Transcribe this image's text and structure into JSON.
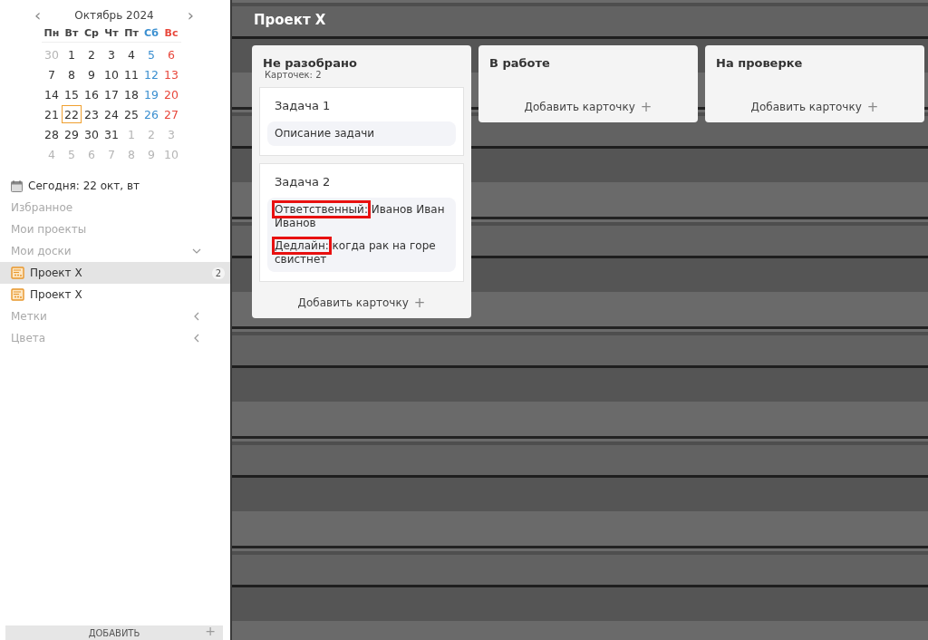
{
  "calendar": {
    "month": "Октябрь 2024",
    "prev": "‹",
    "next": "›",
    "weekdays": [
      {
        "label": "Пн",
        "color": "#444444"
      },
      {
        "label": "Вт",
        "color": "#444444"
      },
      {
        "label": "Ср",
        "color": "#444444"
      },
      {
        "label": "Чт",
        "color": "#444444"
      },
      {
        "label": "Пт",
        "color": "#444444"
      },
      {
        "label": "Сб",
        "color": "#3a8fd0"
      },
      {
        "label": "Вс",
        "color": "#e8473b"
      }
    ],
    "weeks": [
      [
        {
          "day": "30",
          "muted": true,
          "selected": false
        },
        {
          "day": "1",
          "muted": false,
          "selected": false
        },
        {
          "day": "2",
          "muted": false,
          "selected": false
        },
        {
          "day": "3",
          "muted": false,
          "selected": false
        },
        {
          "day": "4",
          "muted": false,
          "selected": false
        },
        {
          "day": "5",
          "muted": false,
          "selected": false
        },
        {
          "day": "6",
          "muted": false,
          "selected": false
        }
      ],
      [
        {
          "day": "7",
          "muted": false,
          "selected": false
        },
        {
          "day": "8",
          "muted": false,
          "selected": false
        },
        {
          "day": "9",
          "muted": false,
          "selected": false
        },
        {
          "day": "10",
          "muted": false,
          "selected": false
        },
        {
          "day": "11",
          "muted": false,
          "selected": false
        },
        {
          "day": "12",
          "muted": false,
          "selected": false
        },
        {
          "day": "13",
          "muted": false,
          "selected": false
        }
      ],
      [
        {
          "day": "14",
          "muted": false,
          "selected": false
        },
        {
          "day": "15",
          "muted": false,
          "selected": false
        },
        {
          "day": "16",
          "muted": false,
          "selected": false
        },
        {
          "day": "17",
          "muted": false,
          "selected": false
        },
        {
          "day": "18",
          "muted": false,
          "selected": false
        },
        {
          "day": "19",
          "muted": false,
          "selected": false
        },
        {
          "day": "20",
          "muted": false,
          "selected": false
        }
      ],
      [
        {
          "day": "21",
          "muted": false,
          "selected": false
        },
        {
          "day": "22",
          "muted": false,
          "selected": true
        },
        {
          "day": "23",
          "muted": false,
          "selected": false
        },
        {
          "day": "24",
          "muted": false,
          "selected": false
        },
        {
          "day": "25",
          "muted": false,
          "selected": false
        },
        {
          "day": "26",
          "muted": false,
          "selected": false
        },
        {
          "day": "27",
          "muted": false,
          "selected": false
        }
      ],
      [
        {
          "day": "28",
          "muted": false,
          "selected": false
        },
        {
          "day": "29",
          "muted": false,
          "selected": false
        },
        {
          "day": "30",
          "muted": false,
          "selected": false
        },
        {
          "day": "31",
          "muted": false,
          "selected": false
        },
        {
          "day": "1",
          "muted": true,
          "selected": false
        },
        {
          "day": "2",
          "muted": true,
          "selected": false
        },
        {
          "day": "3",
          "muted": true,
          "selected": false
        }
      ],
      [
        {
          "day": "4",
          "muted": true,
          "selected": false
        },
        {
          "day": "5",
          "muted": true,
          "selected": false
        },
        {
          "day": "6",
          "muted": true,
          "selected": false
        },
        {
          "day": "7",
          "muted": true,
          "selected": false
        },
        {
          "day": "8",
          "muted": true,
          "selected": false
        },
        {
          "day": "9",
          "muted": true,
          "selected": false
        },
        {
          "day": "10",
          "muted": true,
          "selected": false
        }
      ]
    ]
  },
  "today": "Сегодня: 22 окт, вт",
  "sidebar": {
    "items": [
      {
        "label": "Избранное",
        "kind": "plain"
      },
      {
        "label": "Мои проекты",
        "kind": "plain"
      },
      {
        "label": "Мои доски",
        "kind": "group",
        "expanded": true,
        "children": [
          {
            "label": "Проект X",
            "selected": true,
            "badge": "2"
          },
          {
            "label": "Проект X",
            "selected": false
          }
        ]
      },
      {
        "label": "Метки",
        "kind": "group",
        "expanded": false
      },
      {
        "label": "Цвета",
        "kind": "group",
        "expanded": false
      }
    ],
    "add_button": "ДОБАВИТЬ",
    "add_icon": "+"
  },
  "board": {
    "title": "Проект X",
    "columns": [
      {
        "title": "Не разобрано",
        "count": "Карточек: 2",
        "cards": [
          {
            "title": "Задача 1",
            "fields": [
              {
                "kind": "text",
                "value": "Описание задачи"
              }
            ]
          },
          {
            "title": "Задача 2",
            "fields": [
              {
                "kind": "labeled",
                "label": "Ответственный:",
                "value": " Иванов Иван Иванов",
                "highlighted": true
              },
              {
                "kind": "labeled",
                "label": "Дедлайн:",
                "value": " когда рак на горе свистнет",
                "highlighted": true
              }
            ]
          }
        ],
        "add": "Добавить карточку",
        "add_icon": "+"
      },
      {
        "title": "В работе",
        "add": "Добавить карточку",
        "add_icon": "+"
      },
      {
        "title": "На проверке",
        "add": "Добавить карточку",
        "add_icon": "+"
      }
    ]
  }
}
